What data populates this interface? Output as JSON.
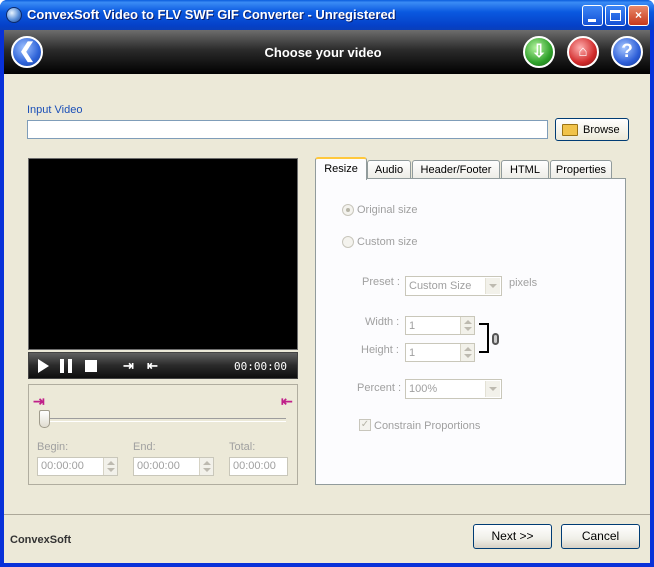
{
  "window": {
    "title": "ConvexSoft Video to FLV  SWF  GIF Converter - Unregistered",
    "controls": {
      "minimize": "minimize",
      "maximize": "maximize",
      "close": "×"
    }
  },
  "header": {
    "title": "Choose your video",
    "back_glyph": "❮",
    "download_glyph": "⇩",
    "home_glyph": "⌂",
    "help_glyph": "?"
  },
  "input": {
    "label": "Input Video",
    "value": "",
    "browse_label": "Browse"
  },
  "player": {
    "time": "00:00:00",
    "mark_in_glyph": "⇥",
    "mark_out_glyph": "⇤"
  },
  "trim": {
    "marker_glyph": "⇥",
    "marker_out_glyph": "⇤",
    "begin_label": "Begin:",
    "begin_value": "00:00:00",
    "end_label": "End:",
    "end_value": "00:00:00",
    "total_label": "Total:",
    "total_value": "00:00:00"
  },
  "tabs": [
    "Resize",
    "Audio",
    "Header/Footer",
    "HTML",
    "Properties"
  ],
  "resize": {
    "original_size_label": "Original size",
    "custom_size_label": "Custom size",
    "preset_label": "Preset :",
    "preset_value": "Custom Size",
    "preset_unit": "pixels",
    "width_label": "Width :",
    "width_value": "1",
    "height_label": "Height :",
    "height_value": "1",
    "percent_label": "Percent :",
    "percent_value": "100%",
    "constrain_label": "Constrain Proportions",
    "check_glyph": "✓"
  },
  "footer": {
    "brand": "ConvexSoft",
    "next_label": "Next >>",
    "cancel_label": "Cancel"
  },
  "colors": {
    "titlebar": "#0a59e0",
    "header_band": "#000000",
    "label_blue": "#1a4fb8"
  }
}
